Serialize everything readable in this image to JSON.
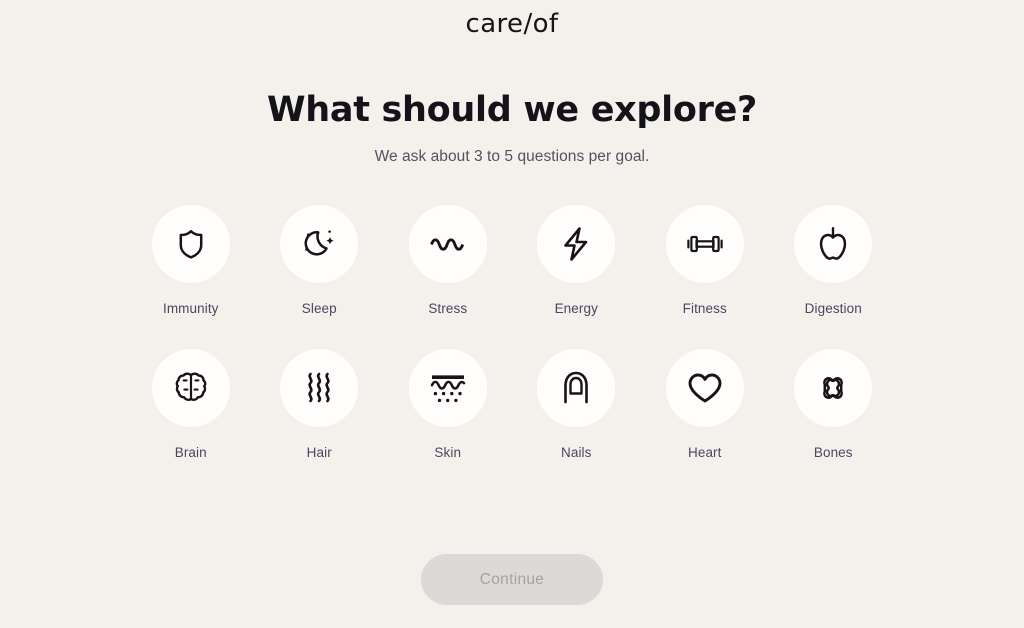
{
  "brand": {
    "name": "care/of",
    "logo_icon": "careof-wordmark"
  },
  "header": {
    "title": "What should we explore?",
    "subtitle": "We ask about 3 to 5 questions per goal."
  },
  "colors": {
    "background": "#f4f1ec",
    "bubble": "#fffefc",
    "label_text": "#4b4660",
    "heading_text": "#15131a",
    "subtitle_text": "#55505f",
    "icon_stroke": "#16141a",
    "button_disabled_bg": "#dcdad8",
    "button_disabled_text": "#a5a3a2"
  },
  "goals": [
    {
      "label": "Immunity",
      "icon": "shield-icon",
      "selected": false
    },
    {
      "label": "Sleep",
      "icon": "moon-icon",
      "selected": false
    },
    {
      "label": "Stress",
      "icon": "squiggle-icon",
      "selected": false
    },
    {
      "label": "Energy",
      "icon": "bolt-icon",
      "selected": false
    },
    {
      "label": "Fitness",
      "icon": "dumbbell-icon",
      "selected": false
    },
    {
      "label": "Digestion",
      "icon": "apple-icon",
      "selected": false
    },
    {
      "label": "Brain",
      "icon": "brain-icon",
      "selected": false
    },
    {
      "label": "Hair",
      "icon": "hair-waves-icon",
      "selected": false
    },
    {
      "label": "Skin",
      "icon": "skin-layers-icon",
      "selected": false
    },
    {
      "label": "Nails",
      "icon": "fingernail-icon",
      "selected": false
    },
    {
      "label": "Heart",
      "icon": "heart-icon",
      "selected": false
    },
    {
      "label": "Bones",
      "icon": "bone-icon",
      "selected": false
    }
  ],
  "footer": {
    "continue_label": "Continue",
    "continue_disabled": true
  }
}
